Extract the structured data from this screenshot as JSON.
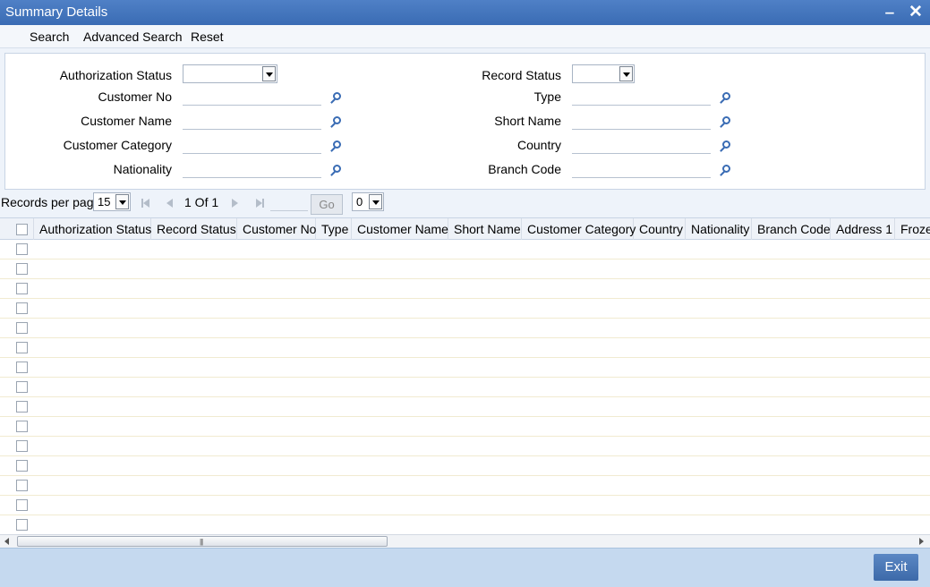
{
  "window": {
    "title": "Summary Details"
  },
  "menu": {
    "search": "Search",
    "advanced_search": "Advanced Search",
    "reset": "Reset"
  },
  "criteria": {
    "authorization_status": "Authorization Status",
    "customer_no": "Customer No",
    "customer_name": "Customer Name",
    "customer_category": "Customer Category",
    "nationality": "Nationality",
    "record_status": "Record Status",
    "type": "Type",
    "short_name": "Short Name",
    "country": "Country",
    "branch_code": "Branch Code"
  },
  "pager": {
    "records_per_page_label": "Records per page",
    "records_per_page_value": "15",
    "page_info": "1 Of 1",
    "go_label": "Go",
    "goto_select_value": "0"
  },
  "grid": {
    "columns": [
      "Authorization Status",
      "Record Status",
      "Customer No",
      "Type",
      "Customer Name",
      "Short Name",
      "Customer Category",
      "Country",
      "Nationality",
      "Branch Code",
      "Address 1",
      "Froze"
    ],
    "row_count": 15
  },
  "footer": {
    "exit_label": "Exit"
  },
  "colors": {
    "title_bar": "#3a6cb4",
    "footer": "#c5d9ef",
    "accent": "#3d6aa9"
  }
}
